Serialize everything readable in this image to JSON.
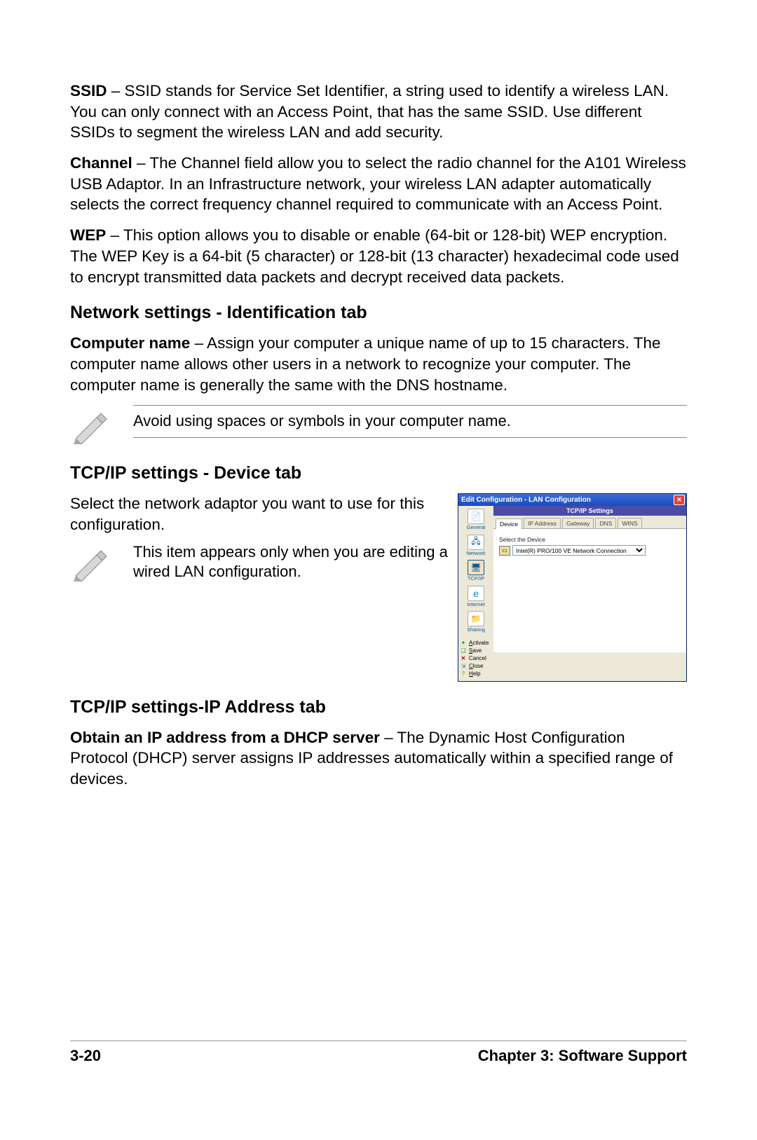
{
  "paragraphs": {
    "ssid_label": "SSID",
    "ssid_text": " – SSID stands for Service Set Identifier, a string used to identify a wireless LAN. You can only connect with an Access Point, that has the same SSID. Use different SSIDs to segment the wireless LAN and add security.",
    "channel_label": "Channel",
    "channel_text": " – The Channel field allow you to select the radio channel for the A101 Wireless USB Adaptor. In an Infrastructure network, your wireless LAN adapter automatically selects the correct frequency channel required to communicate with an Access Point.",
    "wep_label": "WEP",
    "wep_text": " – This option allows you to disable or enable (64-bit or 128-bit) WEP encryption. The WEP Key is a 64-bit (5 character) or 128-bit (13 character) hexadecimal code used to encrypt transmitted data packets and decrypt received data packets."
  },
  "sections": {
    "identification_heading": "Network settings - Identification tab",
    "computer_name_label": "Computer name",
    "computer_name_text": " – Assign your computer a unique name of up to 15 characters. The computer name allows other users in a network to recognize your computer. The computer name is generally the same with the DNS hostname.",
    "note1": "Avoid using spaces or symbols in your computer name.",
    "tcpip_device_heading": "TCP/IP settings - Device tab",
    "tcpip_device_intro": "Select the network adaptor you want to use for this configuration.",
    "note2": "This item appears only when you are editing a wired LAN configuration.",
    "tcpip_ip_heading": "TCP/IP settings-IP Address tab",
    "dhcp_label": "Obtain an IP address from a DHCP server",
    "dhcp_text": " – The Dynamic Host Configuration Protocol (DHCP) server assigns IP addresses automatically within a specified range of devices."
  },
  "dialog": {
    "title": "Edit Configuration - LAN Configuration",
    "panel_title": "TCP/IP Settings",
    "tabs": [
      "Device",
      "IP Address",
      "Gateway",
      "DNS",
      "WINS"
    ],
    "sidebar": {
      "general": "General",
      "network": "Network",
      "tcpip": "TCP/IP",
      "internet": "Internet",
      "sharing": "Sharing"
    },
    "actions": {
      "activate": "Activate",
      "save": "Save",
      "cancel": "Cancel",
      "close": "Close",
      "help": "Help"
    },
    "device_section_label": "Select the Device",
    "device_value": "Intel(R) PRO/100 VE Network Connection"
  },
  "footer": {
    "page": "3-20",
    "chapter": "Chapter 3: Software Support"
  }
}
